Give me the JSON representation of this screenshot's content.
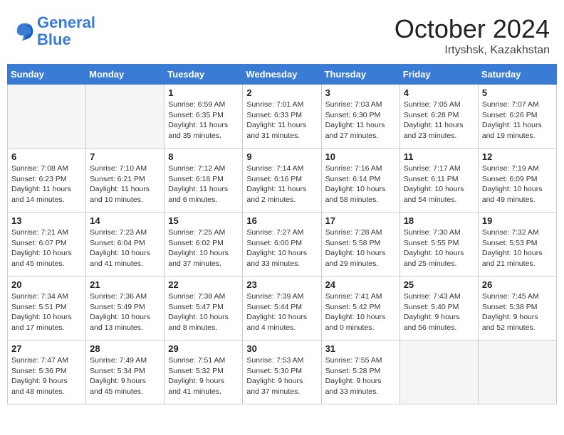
{
  "header": {
    "logo_text_general": "General",
    "logo_text_blue": "Blue",
    "month": "October 2024",
    "location": "Irtyshsk, Kazakhstan"
  },
  "days_of_week": [
    "Sunday",
    "Monday",
    "Tuesday",
    "Wednesday",
    "Thursday",
    "Friday",
    "Saturday"
  ],
  "weeks": [
    [
      {
        "num": "",
        "sunrise": "",
        "sunset": "",
        "daylight": "",
        "empty": true
      },
      {
        "num": "",
        "sunrise": "",
        "sunset": "",
        "daylight": "",
        "empty": true
      },
      {
        "num": "1",
        "sunrise": "Sunrise: 6:59 AM",
        "sunset": "Sunset: 6:35 PM",
        "daylight": "Daylight: 11 hours and 35 minutes."
      },
      {
        "num": "2",
        "sunrise": "Sunrise: 7:01 AM",
        "sunset": "Sunset: 6:33 PM",
        "daylight": "Daylight: 11 hours and 31 minutes."
      },
      {
        "num": "3",
        "sunrise": "Sunrise: 7:03 AM",
        "sunset": "Sunset: 6:30 PM",
        "daylight": "Daylight: 11 hours and 27 minutes."
      },
      {
        "num": "4",
        "sunrise": "Sunrise: 7:05 AM",
        "sunset": "Sunset: 6:28 PM",
        "daylight": "Daylight: 11 hours and 23 minutes."
      },
      {
        "num": "5",
        "sunrise": "Sunrise: 7:07 AM",
        "sunset": "Sunset: 6:26 PM",
        "daylight": "Daylight: 11 hours and 19 minutes."
      }
    ],
    [
      {
        "num": "6",
        "sunrise": "Sunrise: 7:08 AM",
        "sunset": "Sunset: 6:23 PM",
        "daylight": "Daylight: 11 hours and 14 minutes."
      },
      {
        "num": "7",
        "sunrise": "Sunrise: 7:10 AM",
        "sunset": "Sunset: 6:21 PM",
        "daylight": "Daylight: 11 hours and 10 minutes."
      },
      {
        "num": "8",
        "sunrise": "Sunrise: 7:12 AM",
        "sunset": "Sunset: 6:18 PM",
        "daylight": "Daylight: 11 hours and 6 minutes."
      },
      {
        "num": "9",
        "sunrise": "Sunrise: 7:14 AM",
        "sunset": "Sunset: 6:16 PM",
        "daylight": "Daylight: 11 hours and 2 minutes."
      },
      {
        "num": "10",
        "sunrise": "Sunrise: 7:16 AM",
        "sunset": "Sunset: 6:14 PM",
        "daylight": "Daylight: 10 hours and 58 minutes."
      },
      {
        "num": "11",
        "sunrise": "Sunrise: 7:17 AM",
        "sunset": "Sunset: 6:11 PM",
        "daylight": "Daylight: 10 hours and 54 minutes."
      },
      {
        "num": "12",
        "sunrise": "Sunrise: 7:19 AM",
        "sunset": "Sunset: 6:09 PM",
        "daylight": "Daylight: 10 hours and 49 minutes."
      }
    ],
    [
      {
        "num": "13",
        "sunrise": "Sunrise: 7:21 AM",
        "sunset": "Sunset: 6:07 PM",
        "daylight": "Daylight: 10 hours and 45 minutes."
      },
      {
        "num": "14",
        "sunrise": "Sunrise: 7:23 AM",
        "sunset": "Sunset: 6:04 PM",
        "daylight": "Daylight: 10 hours and 41 minutes."
      },
      {
        "num": "15",
        "sunrise": "Sunrise: 7:25 AM",
        "sunset": "Sunset: 6:02 PM",
        "daylight": "Daylight: 10 hours and 37 minutes."
      },
      {
        "num": "16",
        "sunrise": "Sunrise: 7:27 AM",
        "sunset": "Sunset: 6:00 PM",
        "daylight": "Daylight: 10 hours and 33 minutes."
      },
      {
        "num": "17",
        "sunrise": "Sunrise: 7:28 AM",
        "sunset": "Sunset: 5:58 PM",
        "daylight": "Daylight: 10 hours and 29 minutes."
      },
      {
        "num": "18",
        "sunrise": "Sunrise: 7:30 AM",
        "sunset": "Sunset: 5:55 PM",
        "daylight": "Daylight: 10 hours and 25 minutes."
      },
      {
        "num": "19",
        "sunrise": "Sunrise: 7:32 AM",
        "sunset": "Sunset: 5:53 PM",
        "daylight": "Daylight: 10 hours and 21 minutes."
      }
    ],
    [
      {
        "num": "20",
        "sunrise": "Sunrise: 7:34 AM",
        "sunset": "Sunset: 5:51 PM",
        "daylight": "Daylight: 10 hours and 17 minutes."
      },
      {
        "num": "21",
        "sunrise": "Sunrise: 7:36 AM",
        "sunset": "Sunset: 5:49 PM",
        "daylight": "Daylight: 10 hours and 13 minutes."
      },
      {
        "num": "22",
        "sunrise": "Sunrise: 7:38 AM",
        "sunset": "Sunset: 5:47 PM",
        "daylight": "Daylight: 10 hours and 8 minutes."
      },
      {
        "num": "23",
        "sunrise": "Sunrise: 7:39 AM",
        "sunset": "Sunset: 5:44 PM",
        "daylight": "Daylight: 10 hours and 4 minutes."
      },
      {
        "num": "24",
        "sunrise": "Sunrise: 7:41 AM",
        "sunset": "Sunset: 5:42 PM",
        "daylight": "Daylight: 10 hours and 0 minutes."
      },
      {
        "num": "25",
        "sunrise": "Sunrise: 7:43 AM",
        "sunset": "Sunset: 5:40 PM",
        "daylight": "Daylight: 9 hours and 56 minutes."
      },
      {
        "num": "26",
        "sunrise": "Sunrise: 7:45 AM",
        "sunset": "Sunset: 5:38 PM",
        "daylight": "Daylight: 9 hours and 52 minutes."
      }
    ],
    [
      {
        "num": "27",
        "sunrise": "Sunrise: 7:47 AM",
        "sunset": "Sunset: 5:36 PM",
        "daylight": "Daylight: 9 hours and 48 minutes."
      },
      {
        "num": "28",
        "sunrise": "Sunrise: 7:49 AM",
        "sunset": "Sunset: 5:34 PM",
        "daylight": "Daylight: 9 hours and 45 minutes."
      },
      {
        "num": "29",
        "sunrise": "Sunrise: 7:51 AM",
        "sunset": "Sunset: 5:32 PM",
        "daylight": "Daylight: 9 hours and 41 minutes."
      },
      {
        "num": "30",
        "sunrise": "Sunrise: 7:53 AM",
        "sunset": "Sunset: 5:30 PM",
        "daylight": "Daylight: 9 hours and 37 minutes."
      },
      {
        "num": "31",
        "sunrise": "Sunrise: 7:55 AM",
        "sunset": "Sunset: 5:28 PM",
        "daylight": "Daylight: 9 hours and 33 minutes."
      },
      {
        "num": "",
        "sunrise": "",
        "sunset": "",
        "daylight": "",
        "empty": true
      },
      {
        "num": "",
        "sunrise": "",
        "sunset": "",
        "daylight": "",
        "empty": true
      }
    ]
  ]
}
